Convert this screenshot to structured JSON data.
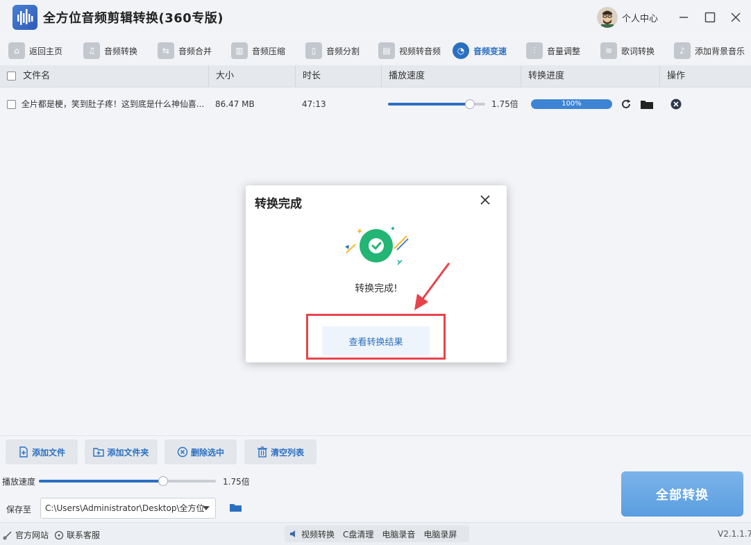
{
  "app": {
    "title": "全方位音频剪辑转换(360专版)",
    "user_center": "个人中心"
  },
  "toolbar": [
    {
      "label": "返回主页",
      "icon": "home-icon"
    },
    {
      "label": "音频转换",
      "icon": "music-note-icon"
    },
    {
      "label": "音频合并",
      "icon": "merge-icon"
    },
    {
      "label": "音频压缩",
      "icon": "compress-icon"
    },
    {
      "label": "音频分割",
      "icon": "split-icon"
    },
    {
      "label": "视频转音频",
      "icon": "film-icon"
    },
    {
      "label": "音频变速",
      "icon": "speed-gauge-icon",
      "active": true
    },
    {
      "label": "音量调整",
      "icon": "volume-sliders-icon"
    },
    {
      "label": "歌词转换",
      "icon": "lyrics-icon"
    },
    {
      "label": "添加背景音乐",
      "icon": "background-music-icon"
    }
  ],
  "table": {
    "headers": [
      "文件名",
      "大小",
      "时长",
      "播放速度",
      "转换进度",
      "操作"
    ],
    "rows": [
      {
        "filename": "全片都是梗，笑到肚子疼！这到底是什么神仙喜...",
        "size": "86.47 MB",
        "duration": "47:13",
        "speed": 1.75,
        "speed_label": "1.75倍",
        "progress": 1.0,
        "progress_label": "100%"
      }
    ]
  },
  "bottom": {
    "buttons": [
      "添加文件",
      "添加文件夹",
      "删除选中",
      "清空列表"
    ],
    "speed_label": "播放速度",
    "speed_value": "1.75倍",
    "speed_level": 0.7,
    "save_label": "保存至",
    "save_path": "C:\\Users\\Administrator\\Desktop\\全方位",
    "convert_all": "全部转换"
  },
  "statusbar": {
    "website": "官方网站",
    "support": "联系客服",
    "center_items": [
      "视频转换",
      "C盘清理",
      "电脑录音",
      "电脑录屏"
    ],
    "version": "V2.1.1.7"
  },
  "modal": {
    "title": "转换完成",
    "message": "转换完成!",
    "view_button": "查看转换结果"
  },
  "colors": {
    "accent": "#2b6fc1",
    "success": "#22b573",
    "highlight": "#e8434b"
  }
}
